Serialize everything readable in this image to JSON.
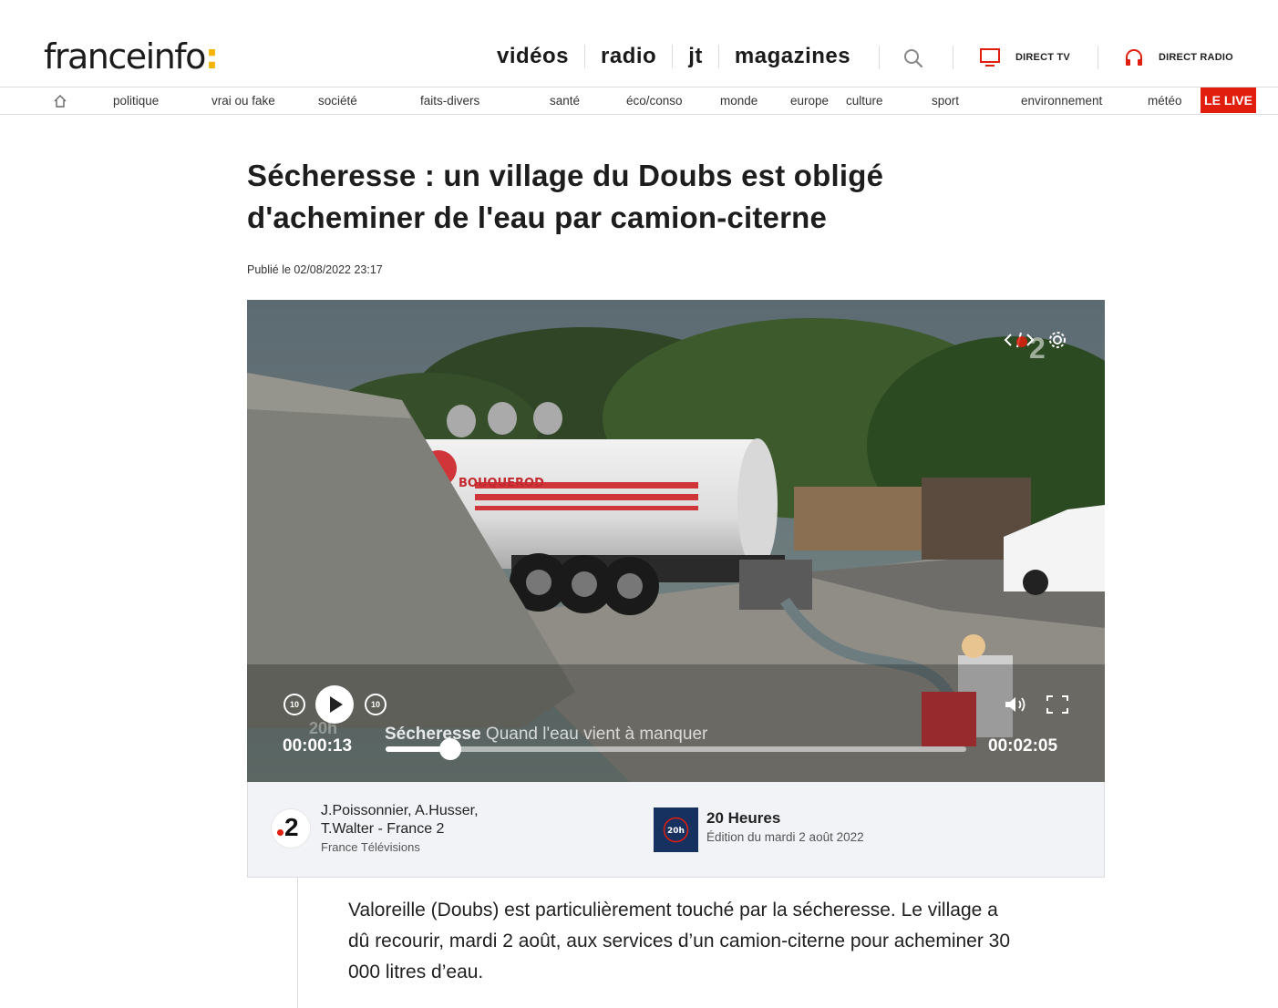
{
  "header": {
    "logo_text": "franceinfo",
    "logo_colon": ":",
    "nav": [
      "vidéos",
      "radio",
      "jt",
      "magazines"
    ],
    "direct_tv": "DIRECT TV",
    "direct_radio": "DIRECT RADIO"
  },
  "categories": [
    "politique",
    "vrai ou fake",
    "société",
    "faits-divers",
    "santé",
    "éco/conso",
    "monde",
    "europe",
    "culture",
    "sport",
    "environnement",
    "météo"
  ],
  "live_label": "LE LIVE",
  "article": {
    "title": "Sécheresse : un village du Doubs est obligé d'acheminer de l'eau par camion-citerne",
    "published": "Publié le 02/08/2022 23:17",
    "chapo": "Valoreille (Doubs) est particulièrement touché par la sécheresse. Le village a dû recourir, mardi 2 août, aux services d’un camion-citerne pour acheminer 30 000 litres d’eau."
  },
  "video": {
    "current_time": "00:00:13",
    "duration": "00:02:05",
    "progress_fraction": 0.112,
    "skip_back_label": "10",
    "skip_fwd_label": "10",
    "lower_third_bold": "Sécheresse",
    "lower_third_text": " Quand l'eau vient à manquer",
    "truck_brand": "BOUQUEROD",
    "channel_badge": "2",
    "corner_label": "20h",
    "embed_icon": "code-icon",
    "settings_icon": "gear-icon"
  },
  "credits": {
    "channel_num": "2",
    "authors": "J.Poissonnier, A.Husser, T.Walter - France 2",
    "org": "France Télévisions",
    "program": "20 Heures",
    "edition": "Édition du mardi 2 août 2022",
    "thumb_label": "20h"
  },
  "colors": {
    "live_red": "#e11d0e",
    "logo_accent": "#f4b400",
    "france2_red": "#e11d0e"
  }
}
